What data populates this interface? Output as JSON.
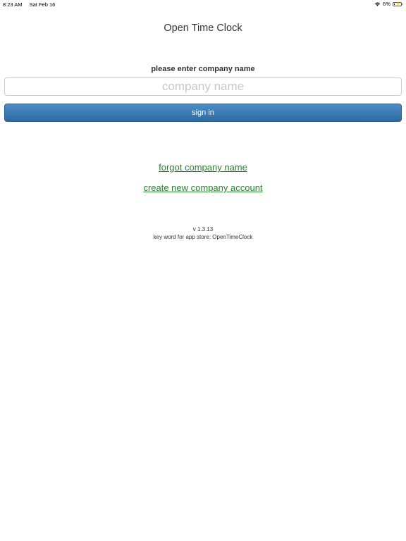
{
  "status_bar": {
    "time": "8:23 AM",
    "date": "Sat Feb 16",
    "battery_percent": "6%",
    "battery_level": 0.06,
    "wifi_icon": "wifi-icon",
    "battery_icon": "battery-charging-icon"
  },
  "app": {
    "title": "Open Time Clock"
  },
  "login": {
    "prompt": "please enter company name",
    "company_value": "",
    "company_placeholder": "company name",
    "sign_in_label": "sign in"
  },
  "links": {
    "forgot": "forgot company name",
    "create": "create new company account"
  },
  "footer": {
    "version": "v 1.3.13",
    "keyword": "key word for app store: OpenTimeClock"
  },
  "colors": {
    "link": "#22862a",
    "button_top": "#4d8cc6",
    "button_bottom": "#2c6aa1",
    "text": "#333333",
    "placeholder": "#c8c8c8"
  }
}
